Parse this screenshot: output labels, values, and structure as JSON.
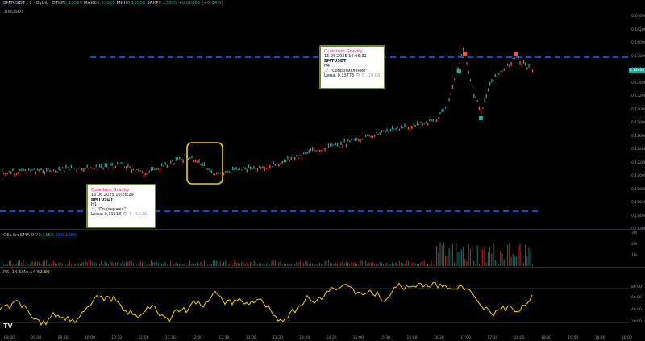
{
  "header": {
    "title": "BMTUSDT · 1 · Bybit",
    "open_label": "OТКР",
    "open_value": "0.13599",
    "high_label": "МАКС",
    "high_value": "0.13625",
    "low_label": "МИН",
    "low_value": "0.13556",
    "close_label": "ЗАКР",
    "close_value": "0.13605",
    "change": "+0.00006 (+0.04%)",
    "subtitle": ".BMUSDT"
  },
  "price_axis": {
    "ticks": [
      "0.14400",
      "0.14200",
      "0.14000",
      "0.13800",
      "0.13600",
      "0.13400",
      "0.13200",
      "0.13000",
      "0.12800",
      "0.12600",
      "0.12400",
      "0.12200",
      "0.12000",
      "0.11800",
      "0.11600",
      "0.11400",
      "0.11200"
    ],
    "last_price": "0.13605"
  },
  "time_axis": {
    "ticks": [
      "08:30",
      "09:00",
      "09:30",
      "10:00",
      "10:30",
      "11:00",
      "11:30",
      "12:00",
      "12:30",
      "13:00",
      "13:30",
      "14:00",
      "14:30",
      "15:00",
      "15:30",
      "16:00",
      "16:30",
      "17:00",
      "17:30",
      "18:00",
      "18:30",
      "19:00",
      "19:30",
      "20:00"
    ]
  },
  "cards": {
    "resistance": {
      "title": "Quantum Gravity",
      "datetime": "16.06.2025 16:06:31",
      "symbol": "BMTUSDT",
      "timeframe": "H4",
      "label": "📈 \"Сопротивление\"",
      "price": "Цена: 0,13773",
      "meta": "👁 5 · 18:06"
    },
    "support": {
      "title": "Quantum Gravity",
      "datetime": "16.06.2025 10:26:29",
      "symbol": "BMTUSDT",
      "timeframe": "H1",
      "label": "📉 \"Поддержка\"",
      "price": "Цена: 0,11518",
      "meta": "👁 7 · 12:26"
    }
  },
  "volume": {
    "label": "Объём SMA 9",
    "value1": "79.115K",
    "value2": "280.218K",
    "axis": [
      "3M",
      "2M",
      "1M"
    ]
  },
  "rsi": {
    "label": "RSI 14 SMA 14",
    "value": "52.80",
    "axis": [
      "80.00",
      "60.00",
      "40.00",
      "20.00"
    ]
  },
  "colors": {
    "up": "#26a69a",
    "down": "#ef5350",
    "level_line": "#2962ff",
    "rsi_line": "#f5d000",
    "highlight_box": "#f5d000"
  }
}
